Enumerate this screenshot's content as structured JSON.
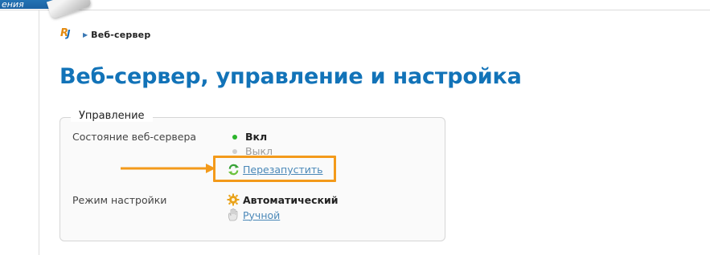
{
  "header": {
    "corner_tab_text": "ения"
  },
  "breadcrumb": {
    "logo": "RU",
    "current": "Веб-сервер"
  },
  "page": {
    "title": "Веб-сервер, управление и настройка"
  },
  "management": {
    "legend": "Управление",
    "server_state": {
      "label": "Состояние веб-сервера",
      "on_label": "Вкл",
      "off_label": "Выкл",
      "selected": "Вкл",
      "restart_link": "Перезапустить"
    },
    "config_mode": {
      "label": "Режим настройки",
      "automatic_label": "Автоматический",
      "manual_link": "Ручной",
      "selected": "Автоматический"
    }
  },
  "colors": {
    "title": "#1273b8",
    "link": "#4a88b8",
    "highlight": "#f39a1a",
    "status_on": "#2bb42b"
  },
  "icons": [
    "logo-icon",
    "breadcrumb-arrow-icon",
    "status-dot-icon",
    "restart-icon",
    "gear-icon",
    "hand-icon",
    "pointer-arrow-icon"
  ]
}
